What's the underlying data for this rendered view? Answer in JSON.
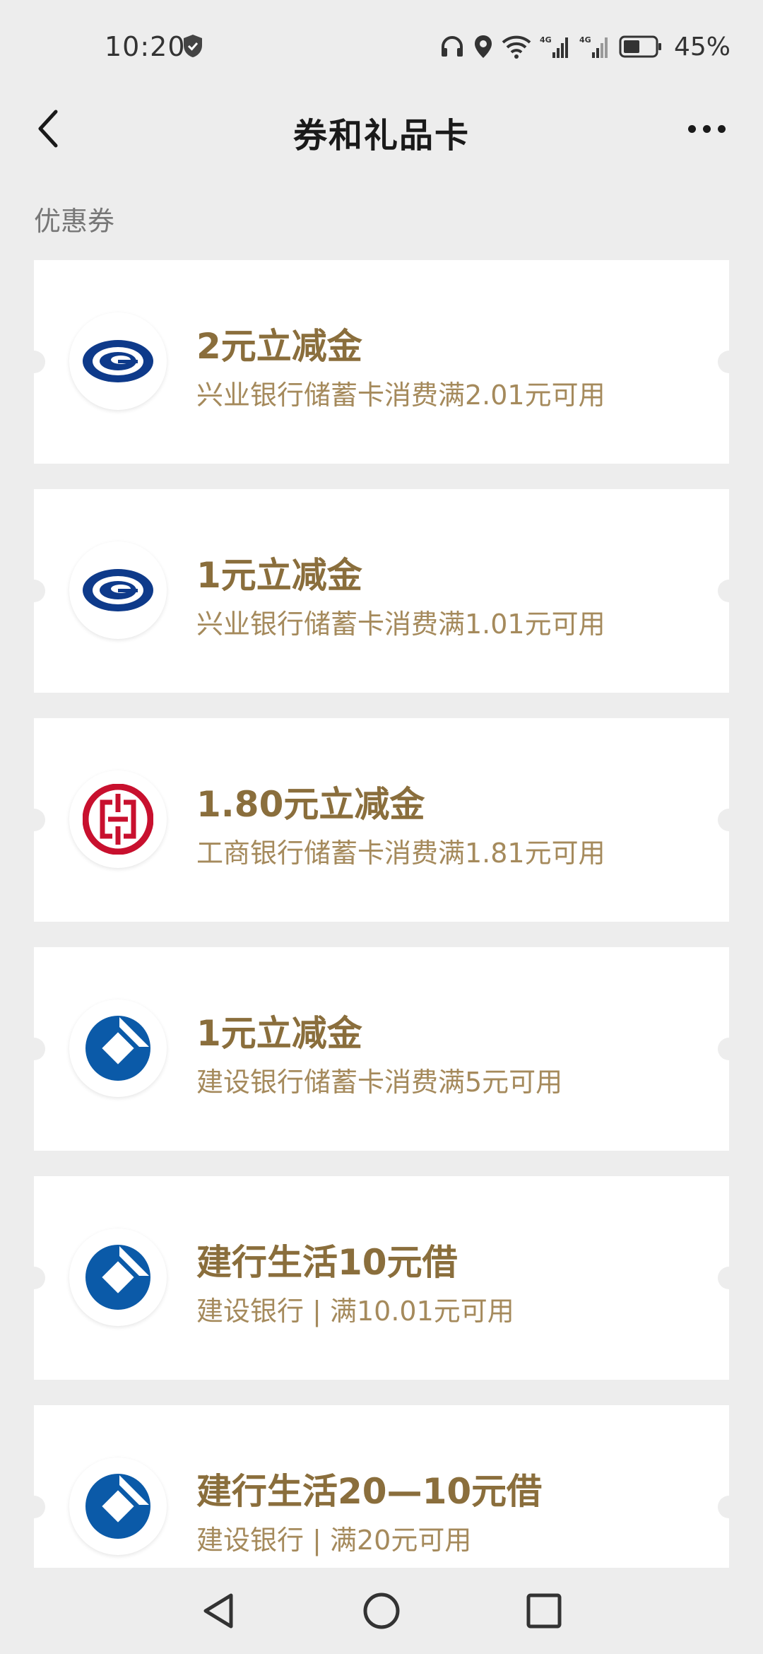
{
  "status_bar": {
    "time": "10:20",
    "battery": "45%",
    "network_1": "4G",
    "network_2": "4G"
  },
  "nav": {
    "title": "券和礼品卡"
  },
  "section": {
    "label": "优惠券"
  },
  "coupons": [
    {
      "bank": "cib",
      "title": "2元立减金",
      "desc": "兴业银行储蓄卡消费满2.01元可用"
    },
    {
      "bank": "cib",
      "title": "1元立减金",
      "desc": "兴业银行储蓄卡消费满1.01元可用"
    },
    {
      "bank": "icbc",
      "title": "1.80元立减金",
      "desc": "工商银行储蓄卡消费满1.81元可用"
    },
    {
      "bank": "ccb",
      "title": "1元立减金",
      "desc": "建设银行储蓄卡消费满5元可用"
    },
    {
      "bank": "ccb",
      "title": "建行生活10元借",
      "desc": "建设银行 | 满10.01元可用"
    },
    {
      "bank": "ccb",
      "title": "建行生活20—10元借",
      "desc": "建设银行 | 满20元可用"
    }
  ],
  "colors": {
    "background": "#ededed",
    "coupon_title": "#8a6e3c",
    "coupon_desc": "#a58a5c",
    "cib_blue": "#0e3a8a",
    "icbc_red": "#c8102e",
    "ccb_blue": "#0b5aa8"
  },
  "icons": {
    "back": "back-chevron-icon",
    "more": "more-dots-icon",
    "sys_back": "triangle-back-icon",
    "sys_home": "circle-home-icon",
    "sys_recent": "square-recent-icon"
  }
}
